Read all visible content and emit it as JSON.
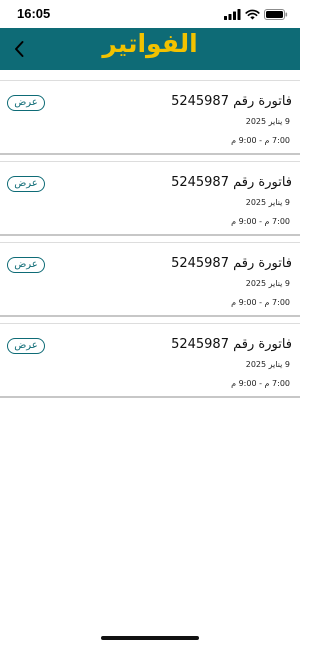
{
  "status_bar": {
    "time": "16:05",
    "icons": [
      "signal-icon",
      "wifi-icon",
      "battery-icon"
    ]
  },
  "header": {
    "title": "الفواتير",
    "back_icon": "chevron-left-icon",
    "background": "#0e6b76",
    "title_color": "#f2c200"
  },
  "invoices": [
    {
      "title": "فاتورة رقم 5245987",
      "date": "9 يناير 2025",
      "time": "7:00 م - 9:00 م",
      "action_label": "عرض"
    },
    {
      "title": "فاتورة رقم 5245987",
      "date": "9 يناير 2025",
      "time": "7:00 م - 9:00 م",
      "action_label": "عرض"
    },
    {
      "title": "فاتورة رقم 5245987",
      "date": "9 يناير 2025",
      "time": "7:00 م - 9:00 م",
      "action_label": "عرض"
    },
    {
      "title": "فاتورة رقم 5245987",
      "date": "9 يناير 2025",
      "time": "7:00 م - 9:00 م",
      "action_label": "عرض"
    }
  ]
}
